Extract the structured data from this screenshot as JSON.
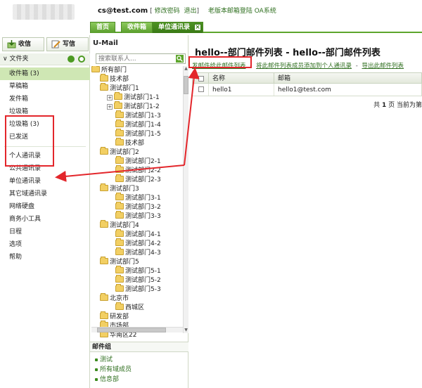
{
  "header": {
    "email": "cs@test.com",
    "bracket_open": "[",
    "change_password": "修改密码",
    "logout": "退出",
    "bracket_close": "]",
    "oa_login": "老版本邮箱登陆 OA系统"
  },
  "tabs": [
    {
      "label": "首页"
    },
    {
      "label": "收件箱"
    },
    {
      "label": "单位通讯录"
    }
  ],
  "leftnav": {
    "receive_label": "收信",
    "compose_label": "写信",
    "folder_header": "文件夹",
    "folders": [
      {
        "label": "收件箱 (3)"
      },
      {
        "label": "草稿箱"
      },
      {
        "label": "发件箱"
      },
      {
        "label": "垃圾箱"
      },
      {
        "label": "垃圾箱 (3)"
      },
      {
        "label": "已发送"
      }
    ],
    "contacts": [
      {
        "label": "个人通讯录"
      },
      {
        "label": "公共通讯录"
      },
      {
        "label": "单位通讯录"
      },
      {
        "label": "其它域通讯录"
      }
    ],
    "tools": [
      {
        "label": "网络硬盘"
      },
      {
        "label": "商务小工具"
      },
      {
        "label": "日程"
      },
      {
        "label": "选项"
      },
      {
        "label": "帮助"
      }
    ]
  },
  "directory": {
    "title": "U-Mail",
    "search_placeholder": "搜索联系人...",
    "tree": [
      {
        "label": "所有部门",
        "level": 0
      },
      {
        "label": "技术部",
        "level": 1
      },
      {
        "label": "测试部门1",
        "level": 1
      },
      {
        "label": "测试部门1-1",
        "level": 2,
        "expander": "+"
      },
      {
        "label": "测试部门1-2",
        "level": 2,
        "expander": "+"
      },
      {
        "label": "测试部门1-3",
        "level": 2
      },
      {
        "label": "测试部门1-4",
        "level": 2
      },
      {
        "label": "测试部门1-5",
        "level": 2
      },
      {
        "label": "技术部",
        "level": 2
      },
      {
        "label": "测试部门2",
        "level": 1
      },
      {
        "label": "测试部门2-1",
        "level": 2
      },
      {
        "label": "测试部门2-2",
        "level": 2
      },
      {
        "label": "测试部门2-3",
        "level": 2
      },
      {
        "label": "测试部门3",
        "level": 1
      },
      {
        "label": "测试部门3-1",
        "level": 2
      },
      {
        "label": "测试部门3-2",
        "level": 2
      },
      {
        "label": "测试部门3-3",
        "level": 2
      },
      {
        "label": "测试部门4",
        "level": 1
      },
      {
        "label": "测试部门4-1",
        "level": 2
      },
      {
        "label": "测试部门4-2",
        "level": 2
      },
      {
        "label": "测试部门4-3",
        "level": 2
      },
      {
        "label": "测试部门5",
        "level": 1
      },
      {
        "label": "测试部门5-1",
        "level": 2
      },
      {
        "label": "测试部门5-2",
        "level": 2
      },
      {
        "label": "测试部门5-3",
        "level": 2
      },
      {
        "label": "北京市",
        "level": 1
      },
      {
        "label": "西城区",
        "level": 2
      },
      {
        "label": "研发部",
        "level": 1
      },
      {
        "label": "市场部",
        "level": 1
      },
      {
        "label": "华南区22",
        "level": 1
      }
    ],
    "group_title": "邮件组",
    "groups": [
      {
        "label": "测试"
      },
      {
        "label": "所有域成员"
      },
      {
        "label": "信息部"
      }
    ]
  },
  "main": {
    "title": "hello--部门邮件列表 - hello--部门邮件列表",
    "action_send": "发邮件给此邮件列表",
    "action_sep1": "-",
    "action_add": "将此邮件列表成员添加到个人通讯录",
    "action_sep2": "-",
    "action_export": "导出此邮件列表",
    "columns": [
      "名称",
      "邮箱"
    ],
    "rows": [
      {
        "name": "hello1",
        "email": "hello1@test.com"
      }
    ],
    "pager_prefix": "共",
    "pager_pages": "1",
    "pager_middle": "页 当前为第"
  },
  "colors": {
    "accent": "#5da62c",
    "link": "#2f6f1f",
    "selected": "#cfe7b4",
    "annotation": "#e3262b"
  }
}
